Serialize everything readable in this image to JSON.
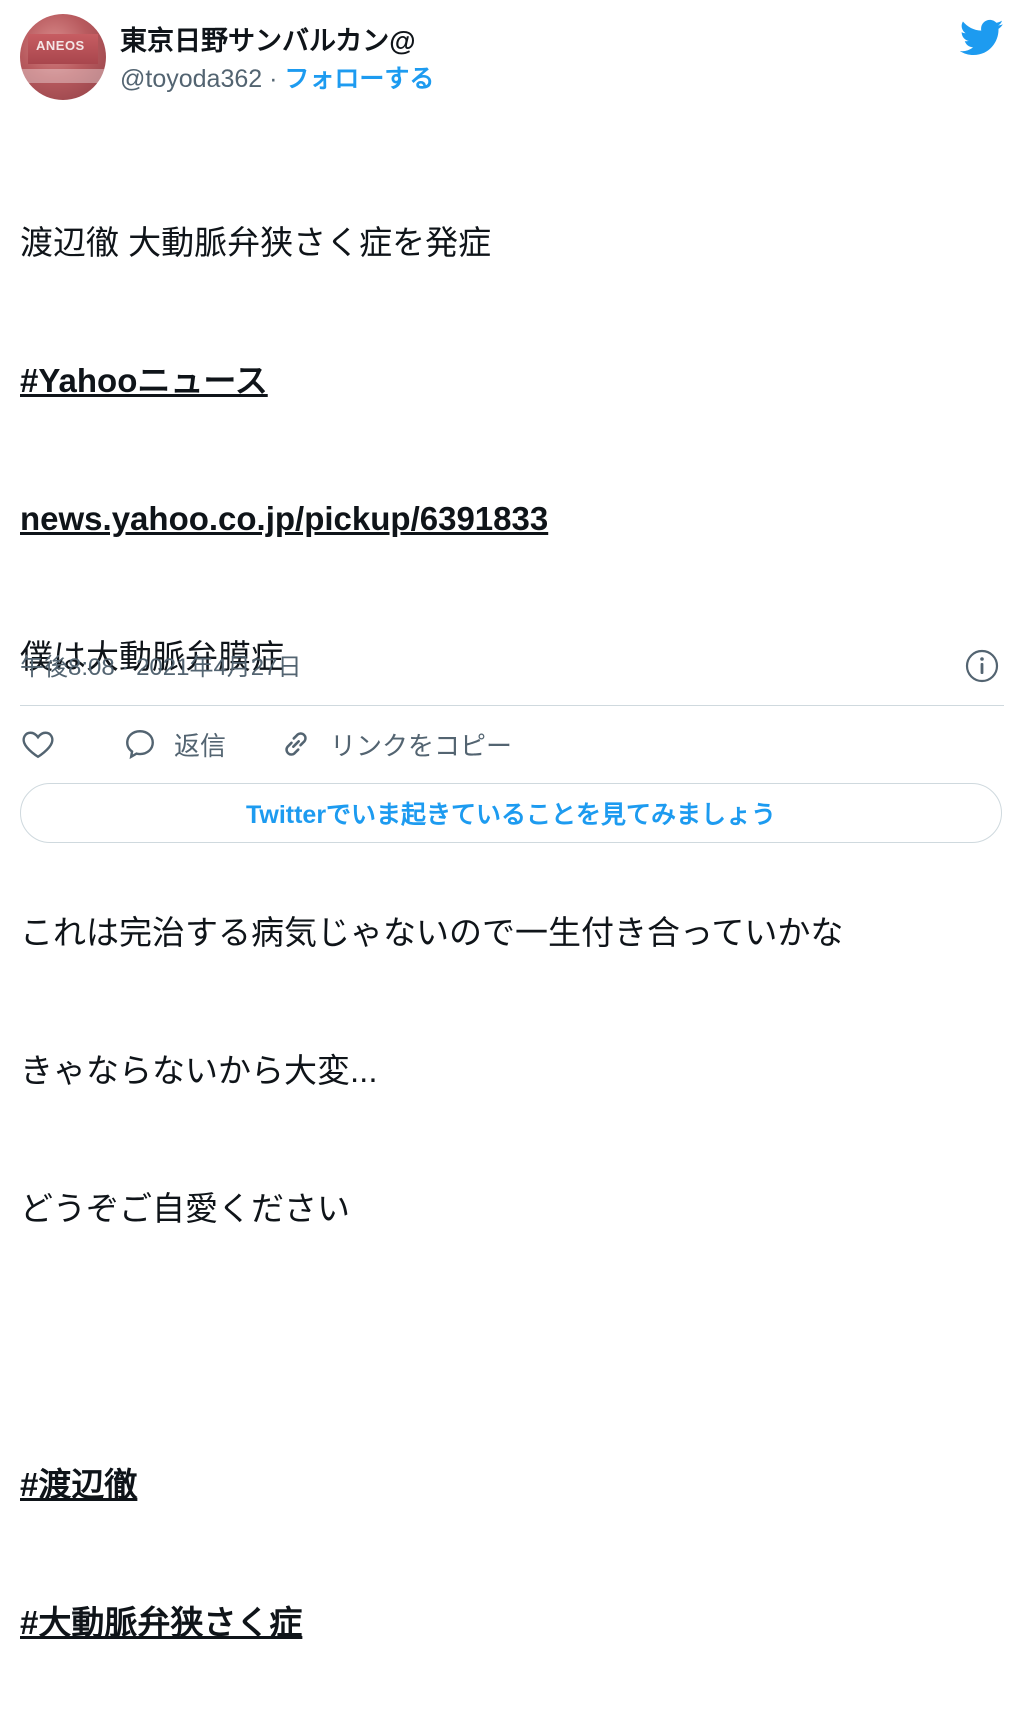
{
  "user": {
    "display_name": "東京日野サンバルカン@",
    "handle": "@toyoda362",
    "separator": "·",
    "follow_label": "フォローする",
    "avatar_text": "ANEOS"
  },
  "tweet": {
    "line1": "渡辺徹 大動脈弁狭さく症を発症",
    "hashtag1": "#Yahooニュース",
    "link": "news.yahoo.co.jp/pickup/6391833",
    "line2": "僕は大動脈弁膜症",
    "line3": "これは完治する病気じゃないので一生付き合っていかな",
    "line4": "きゃならないから大変...",
    "line5": "どうぞご自愛ください",
    "hashtag2": "#渡辺徹",
    "hashtag3": "#大動脈弁狭さく症"
  },
  "meta": {
    "time": "午後8:08",
    "separator": "·",
    "date": "2021年4月27日"
  },
  "actions": {
    "reply_label": "返信",
    "copy_link_label": "リンクをコピー"
  },
  "cta_label": "Twitterでいま起きていることを見てみましょう",
  "colors": {
    "accent": "#1d9bf0",
    "text": "#0f1419",
    "muted": "#536471",
    "border": "#cfd9de"
  },
  "icons": [
    "twitter-bird-icon",
    "info-icon",
    "heart-icon",
    "reply-icon",
    "link-icon"
  ]
}
